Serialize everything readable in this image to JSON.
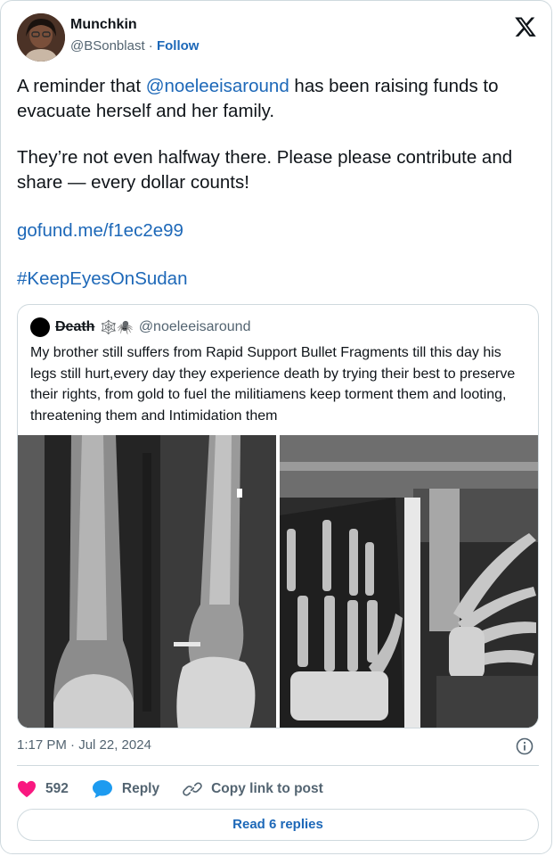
{
  "author": {
    "name": "Munchkin",
    "handle": "@BSonblast",
    "separator": "·",
    "follow_label": "Follow"
  },
  "tweet": {
    "text_part1": "A reminder that ",
    "mention": "@noeleeisaround",
    "text_part2": " has been raising funds to evacuate herself and her family.",
    "paragraph2": "They’re not even halfway there. Please please contribute and share — every dollar counts!",
    "link": "gofund.me/f1ec2e99",
    "hashtag": "#KeepEyesOnSudan"
  },
  "quote": {
    "name": "Death",
    "emojis": "🕸️🕷️",
    "handle": "@noeleeisaround",
    "text": "My brother still suffers from Rapid Support Bullet Fragments till this day his legs still hurt,every day they experience death by trying their best to preserve their rights, from gold to fuel the militiamens keep torment them and looting, threatening them and Intimidation them"
  },
  "timestamp": "1:17 PM · Jul 22, 2024",
  "actions": {
    "like_count": "592",
    "reply_label": "Reply",
    "copy_label": "Copy link to post"
  },
  "read_replies_label": "Read 6 replies",
  "colors": {
    "link": "#1d68b8",
    "like": "#f91880",
    "reply": "#1d9bf0",
    "border": "#cfd9de"
  },
  "icons": {
    "x": "x-logo-icon",
    "info": "info-icon",
    "heart": "heart-icon",
    "reply": "reply-bubble-icon",
    "copy": "link-icon"
  }
}
